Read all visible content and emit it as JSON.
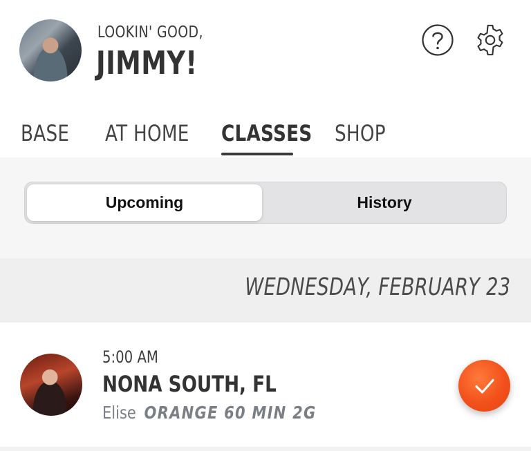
{
  "header": {
    "greeting_small": "LOOKIN' GOOD,",
    "greeting_name": "JIMMY!",
    "help_icon": "question-circle-icon",
    "settings_icon": "gear-icon"
  },
  "tabs": [
    {
      "label": "BASE",
      "active": false
    },
    {
      "label": "AT HOME",
      "active": false
    },
    {
      "label": "CLASSES",
      "active": true
    },
    {
      "label": "SHOP",
      "active": false
    }
  ],
  "segment": {
    "options": [
      "Upcoming",
      "History"
    ],
    "selected": "Upcoming"
  },
  "schedule": {
    "date": "WEDNESDAY, FEBRUARY 23",
    "classes": [
      {
        "time": "5:00 AM",
        "studio": "NONA SOUTH, FL",
        "coach": "Elise",
        "class_name": "ORANGE 60 MIN 2G",
        "status_icon": "checkmark-icon"
      }
    ]
  },
  "colors": {
    "accent": "#f2511b",
    "text": "#333333",
    "muted": "#7a7f86"
  }
}
